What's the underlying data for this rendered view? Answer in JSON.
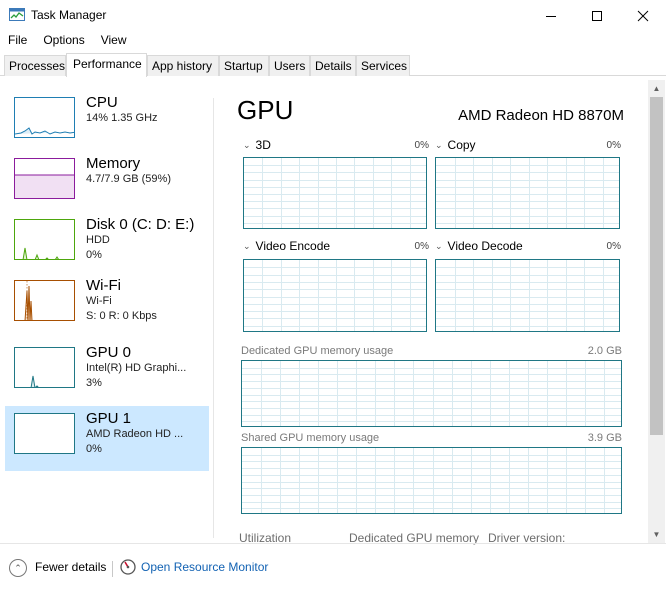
{
  "window": {
    "title": "Task Manager",
    "app_icon": "task-manager-icon",
    "controls": [
      "minimize-icon",
      "maximize-icon",
      "close-icon"
    ]
  },
  "menu": [
    "File",
    "Options",
    "View"
  ],
  "tabs": [
    "Processes",
    "Performance",
    "App history",
    "Startup",
    "Users",
    "Details",
    "Services"
  ],
  "active_tab": "Performance",
  "sidebar": {
    "items": [
      {
        "title": "CPU",
        "line1": "14%  1.35 GHz",
        "line2": "",
        "color": "#1f7eb3"
      },
      {
        "title": "Memory",
        "line1": "4.7/7.9 GB (59%)",
        "line2": "",
        "color": "#8b1b9c"
      },
      {
        "title": "Disk 0 (C: D: E:)",
        "line1": "HDD",
        "line2": "0%",
        "color": "#4da60c"
      },
      {
        "title": "Wi-Fi",
        "line1": "Wi-Fi",
        "line2": "S: 0  R: 0 Kbps",
        "color": "#a74f01"
      },
      {
        "title": "GPU 0",
        "line1": "Intel(R) HD Graphi...",
        "line2": "3%",
        "color": "#1f7785"
      },
      {
        "title": "GPU 1",
        "line1": "AMD Radeon HD ...",
        "line2": "0%",
        "color": "#1f7785"
      }
    ],
    "selected_index": 5
  },
  "main": {
    "title": "GPU",
    "device_name": "AMD Radeon HD 8870M",
    "engines": [
      {
        "label": "3D",
        "percent": "0%"
      },
      {
        "label": "Copy",
        "percent": "0%"
      },
      {
        "label": "Video Encode",
        "percent": "0%"
      },
      {
        "label": "Video Decode",
        "percent": "0%"
      }
    ],
    "dedicated_memory": {
      "label": "Dedicated GPU memory usage",
      "value": "2.0 GB"
    },
    "shared_memory": {
      "label": "Shared GPU memory usage",
      "value": "3.9 GB"
    },
    "stats": [
      "Utilization",
      "Dedicated GPU memory",
      "Driver version:"
    ]
  },
  "footer": {
    "fewer_details": "Fewer details",
    "open_resource_monitor": "Open Resource Monitor"
  },
  "colors": {
    "gpu_graph_border": "#1f7785",
    "grid": "#d9eaf0",
    "selected_bg": "#cce8ff",
    "link": "#1262b3"
  }
}
